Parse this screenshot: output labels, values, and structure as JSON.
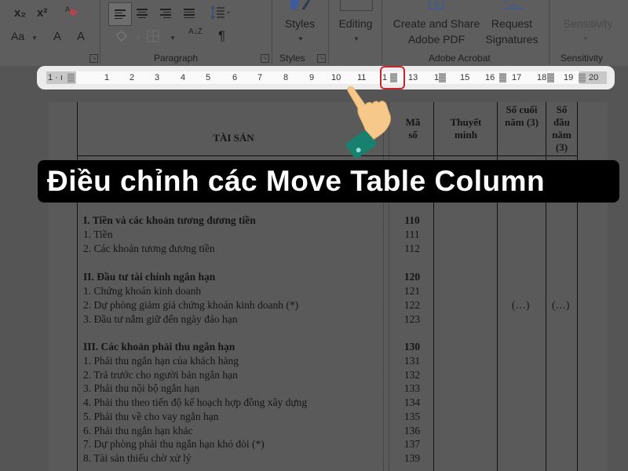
{
  "ribbon": {
    "font_group": {
      "subscript": "x₂",
      "superscript": "x²",
      "change_case": "Aa",
      "grow_font": "A",
      "shrink_font": "A"
    },
    "paragraph_group": {
      "label": "Paragraph",
      "pilcrow": "¶",
      "sort": "A↓Z"
    },
    "styles_group": {
      "button_label": "Styles",
      "label": "Styles"
    },
    "editing": {
      "button_label": "Editing"
    },
    "adobe_group": {
      "create_share_line1": "Create and Share",
      "create_share_line2": "Adobe PDF",
      "request_line1": "Request",
      "request_line2": "Signatures",
      "label": "Adobe Acrobat"
    },
    "sensitivity_group": {
      "button_label": "Sensitivity",
      "label": "Sensitivity"
    }
  },
  "ruler": {
    "left_margin": "1 · ı",
    "ticks": [
      "1",
      "2",
      "3",
      "4",
      "5",
      "6",
      "7",
      "8",
      "9",
      "10",
      "11",
      "1",
      "13",
      "1",
      "15",
      "16",
      "17",
      "18",
      "19",
      "20"
    ],
    "highlight_color": "#c8242b"
  },
  "banner": {
    "text": "Điều chỉnh các Move Table Column"
  },
  "table": {
    "headers": {
      "assets": "TÀI SẢN",
      "code_line1": "Mã",
      "code_line2": "số",
      "note_line1": "Thuyết",
      "note_line2": "minh",
      "end_year_line1": "Số cuối",
      "end_year_line2": "năm (3)",
      "begin_year_line1": "Số",
      "begin_year_line2": "đầu",
      "begin_year_line3": "năm",
      "begin_year_line4": "(3)"
    },
    "rows": [
      {
        "label": "I. Tiền và các khoản tương đương tiền",
        "code": "110",
        "bold": true
      },
      {
        "label": "1. Tiền",
        "code": "111",
        "bold": false
      },
      {
        "label": "2. Các khoản tương đương tiền",
        "code": "112",
        "bold": false
      },
      {
        "label": "II. Đầu tư tài chính ngắn hạn",
        "code": "120",
        "bold": true
      },
      {
        "label": "1. Chứng khoán kinh doanh",
        "code": "121",
        "bold": false
      },
      {
        "label": "2. Dự phòng giảm giá chứng khoán kinh doanh (*)",
        "code": "122",
        "bold": false,
        "end_year": "(…)",
        "begin_year": "(…)"
      },
      {
        "label": "3. Đầu tư nắm giữ đến ngày đáo hạn",
        "code": "123",
        "bold": false
      },
      {
        "label": "III. Các khoản phải thu ngắn hạn",
        "code": "130",
        "bold": true
      },
      {
        "label": "1. Phải thu ngắn hạn của khách hàng",
        "code": "131",
        "bold": false
      },
      {
        "label": "2. Trả trước cho người bán ngắn hạn",
        "code": "132",
        "bold": false
      },
      {
        "label": "3. Phải thu nội bộ ngắn hạn",
        "code": "133",
        "bold": false
      },
      {
        "label": "4. Phải thu theo tiến độ kế hoạch hợp đồng xây dựng",
        "code": "134",
        "bold": false
      },
      {
        "label": "5. Phải thu về cho vay ngắn hạn",
        "code": "135",
        "bold": false
      },
      {
        "label": "6. Phải thu ngắn hạn khác",
        "code": "136",
        "bold": false
      },
      {
        "label": "7. Dự phòng phải thu ngắn hạn khó đòi (*)",
        "code": "137",
        "bold": false
      },
      {
        "label": "8. Tài sản thiếu chờ xử lý",
        "code": "139",
        "bold": false
      }
    ]
  }
}
